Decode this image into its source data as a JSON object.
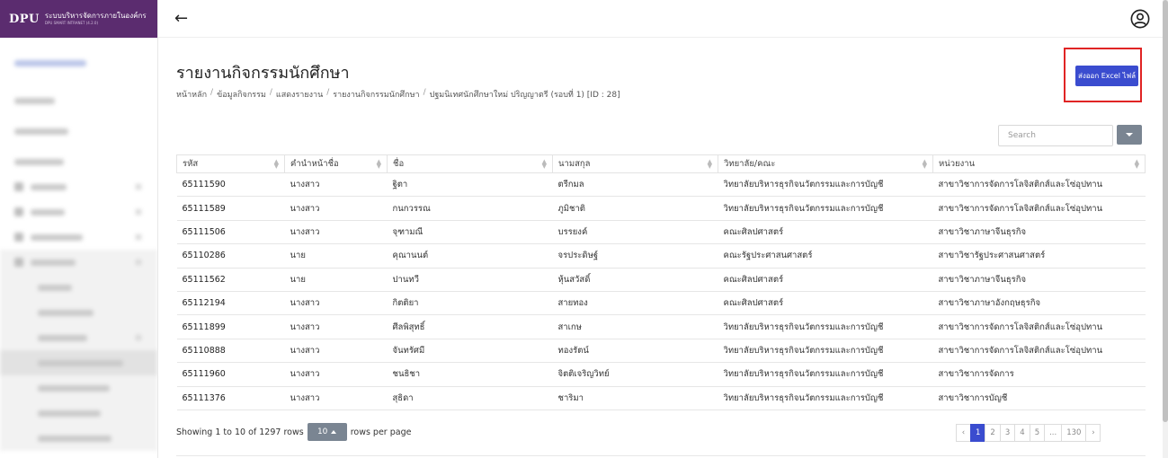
{
  "brand": {
    "logo": "DPU",
    "title": "ระบบบริหารจัดการภายในองค์กร",
    "subtitle": "DPU SMART INTRANET (4.2.0)"
  },
  "page": {
    "title": "รายงานกิจกรรมนักศึกษา",
    "breadcrumb": [
      "หน้าหลัก",
      "ข้อมูลกิจกรรม",
      "แสดงรายงาน",
      "รายงานกิจกรรมนักศึกษา",
      "ปฐมนิเทศนักศึกษาใหม่ ปริญญาตรี (รอบที่ 1) [ID : 28]"
    ],
    "export_label": "ส่งออก Excel ไฟล์"
  },
  "toolbar": {
    "search_placeholder": "Search"
  },
  "table": {
    "columns": [
      "รหัส",
      "คำนำหน้าชื่อ",
      "ชื่อ",
      "นามสกุล",
      "วิทยาลัย/คณะ",
      "หน่วยงาน"
    ],
    "rows": [
      [
        "65111590",
        "นางสาว",
        "ฐิตา",
        "ตรีกมล",
        "วิทยาลัยบริหารธุรกิจนวัตกรรมและการบัญชี",
        "สาขาวิชาการจัดการโลจิสติกส์และโซ่อุปทาน"
      ],
      [
        "65111589",
        "นางสาว",
        "กนกวรรณ",
        "ภูมิชาติ",
        "วิทยาลัยบริหารธุรกิจนวัตกรรมและการบัญชี",
        "สาขาวิชาการจัดการโลจิสติกส์และโซ่อุปทาน"
      ],
      [
        "65111506",
        "นางสาว",
        "จุฑามณี",
        "บรรยงค์",
        "คณะศิลปศาสตร์",
        "สาขาวิชาภาษาจีนธุรกิจ"
      ],
      [
        "65110286",
        "นาย",
        "คุณานนต์",
        "จรประดิษฐ์",
        "คณะรัฐประศาสนศาสตร์",
        "สาขาวิชารัฐประศาสนศาสตร์"
      ],
      [
        "65111562",
        "นาย",
        "ปานทวี",
        "หุ้นสวัสดิ์",
        "คณะศิลปศาสตร์",
        "สาขาวิชาภาษาจีนธุรกิจ"
      ],
      [
        "65112194",
        "นางสาว",
        "กิตติยา",
        "สายทอง",
        "คณะศิลปศาสตร์",
        "สาขาวิชาภาษาอังกฤษธุรกิจ"
      ],
      [
        "65111899",
        "นางสาว",
        "ศีลพิสุทธิ์",
        "สาเกษ",
        "วิทยาลัยบริหารธุรกิจนวัตกรรมและการบัญชี",
        "สาขาวิชาการจัดการโลจิสติกส์และโซ่อุปทาน"
      ],
      [
        "65110888",
        "นางสาว",
        "จันทรัศมี",
        "ทองรัตน์",
        "วิทยาลัยบริหารธุรกิจนวัตกรรมและการบัญชี",
        "สาขาวิชาการจัดการโลจิสติกส์และโซ่อุปทาน"
      ],
      [
        "65111960",
        "นางสาว",
        "ชนธิชา",
        "จิตติเจริญวิทย์",
        "วิทยาลัยบริหารธุรกิจนวัตกรรมและการบัญชี",
        "สาขาวิชาการจัดการ"
      ],
      [
        "65111376",
        "นางสาว",
        "สุธิดา",
        "ชาริมา",
        "วิทยาลัยบริหารธุรกิจนวัตกรรมและการบัญชี",
        "สาขาวิชาการบัญชี"
      ]
    ]
  },
  "footer": {
    "showing": "Showing 1 to 10 of 1297 rows",
    "page_size": "10",
    "rows_per_page": "rows per page",
    "pages": [
      "‹",
      "1",
      "2",
      "3",
      "4",
      "5",
      "...",
      "130",
      "›"
    ],
    "active_page": "1"
  },
  "colors": {
    "brand": "#5b2c6f",
    "accent": "#3a4ccf",
    "highlight": "#e02424"
  }
}
